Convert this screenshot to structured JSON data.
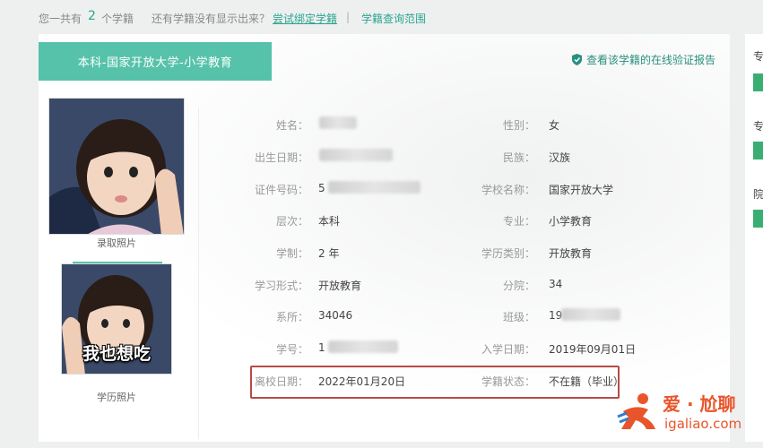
{
  "topbar": {
    "count_prefix": "您一共有",
    "count": "2",
    "count_suffix": "个学籍",
    "question": "还有学籍没有显示出来？",
    "bind_link": "尝试绑定学籍",
    "separator": "|",
    "scope_link": "学籍查询范围"
  },
  "card": {
    "tab_label": "本科-国家开放大学-小学教育",
    "verify_link": "查看该学籍的在线验证报告",
    "photo1_caption": "录取照片",
    "photo2_caption": "学历照片",
    "photo2_overlay": "我也想吃",
    "fields": {
      "name_label": "姓名：",
      "gender_label": "性别：",
      "gender_value": "女",
      "birth_label": "出生日期：",
      "ethnicity_label": "民族：",
      "ethnicity_value": "汉族",
      "id_label": "证件号码：",
      "id_value_partial": "5",
      "school_label": "学校名称：",
      "school_value": "国家开放大学",
      "level_label": "层次：",
      "level_value": "本科",
      "major_label": "专业：",
      "major_value": "小学教育",
      "duration_label": "学制：",
      "duration_value": "2 年",
      "edu_type_label": "学历类别：",
      "edu_type_value": "开放教育",
      "study_form_label": "学习形式：",
      "study_form_value": "开放教育",
      "branch_label": "分院：",
      "branch_value": "34",
      "dept_label": "系所：",
      "dept_value": "34046",
      "class_label": "班级：",
      "class_value_partial": "19",
      "student_no_label": "学号：",
      "student_no_partial": "1",
      "enroll_label": "入学日期：",
      "enroll_value": "2019年09月01日",
      "leave_label": "离校日期：",
      "leave_value": "2022年01月20日",
      "status_label": "学籍状态：",
      "status_value": "不在籍（毕业）"
    }
  },
  "right_panel": {
    "item1": "专",
    "item2": "专",
    "item3": "院"
  },
  "brand": {
    "name": "爱 · 尬聊",
    "domain": "igaliao.com"
  },
  "colors": {
    "accent": "#56c2aa",
    "link": "#2aa58f",
    "highlight_border": "#b84a45",
    "brand": "#e9552b"
  }
}
